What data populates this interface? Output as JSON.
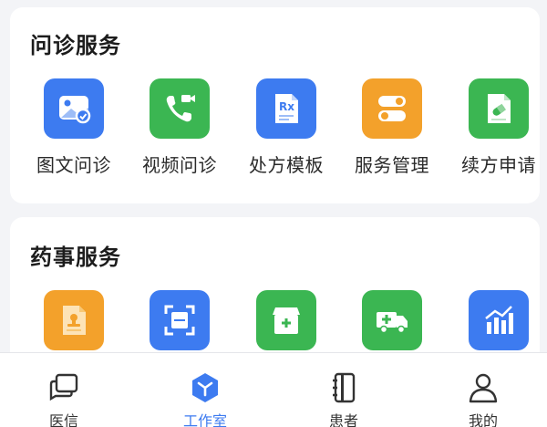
{
  "consult": {
    "title": "问诊服务",
    "items": [
      {
        "label": "图文问诊",
        "icon": "image-chat-icon",
        "color": "#3d7bf0"
      },
      {
        "label": "视频问诊",
        "icon": "video-call-icon",
        "color": "#3bb652"
      },
      {
        "label": "处方模板",
        "icon": "prescription-rx-icon",
        "color": "#3d7bf0"
      },
      {
        "label": "服务管理",
        "icon": "toggle-settings-icon",
        "color": "#f3a12b"
      },
      {
        "label": "续方申请",
        "icon": "renew-prescription-icon",
        "color": "#3bb652"
      }
    ]
  },
  "pharmacy": {
    "title": "药事服务",
    "items": [
      {
        "icon": "stamped-document-icon",
        "color": "#f3a12b"
      },
      {
        "icon": "scan-frame-icon",
        "color": "#3d7bf0"
      },
      {
        "icon": "medicine-box-icon",
        "color": "#3bb652"
      },
      {
        "icon": "ambulance-icon",
        "color": "#3bb652"
      },
      {
        "icon": "bar-chart-icon",
        "color": "#3d7bf0"
      }
    ]
  },
  "tabbar": {
    "active": "工作室",
    "tabs": [
      {
        "label": "医信",
        "icon": "messages-icon"
      },
      {
        "label": "工作室",
        "icon": "workspace-cube-icon"
      },
      {
        "label": "患者",
        "icon": "notebook-icon"
      },
      {
        "label": "我的",
        "icon": "user-icon"
      }
    ]
  }
}
